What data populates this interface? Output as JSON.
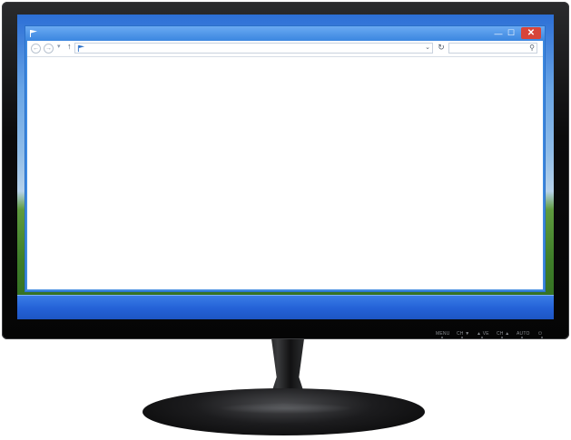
{
  "window": {
    "title": "",
    "icons": {
      "title": "folder-flag-icon",
      "minimize": "minimize-icon",
      "maximize": "maximize-icon",
      "close": "close-icon"
    },
    "controls": {
      "minimize": "—",
      "maximize": "☐",
      "close": "✕"
    }
  },
  "toolbar": {
    "back_symbol": "←",
    "forward_symbol": "→",
    "recent_symbol": "▾",
    "up_symbol": "↑",
    "address_value": "",
    "dropdown_symbol": "⌄",
    "refresh_symbol": "↻",
    "search_value": "",
    "search_symbol": "⚲"
  },
  "monitor": {
    "buttons": [
      "MENU",
      "CH ▼",
      "▲ VE",
      "CH ▲",
      "AUTO",
      "⏻"
    ]
  },
  "colors": {
    "accent": "#2563d8",
    "close": "#d8453a",
    "bezel": "#0b0b0c"
  }
}
